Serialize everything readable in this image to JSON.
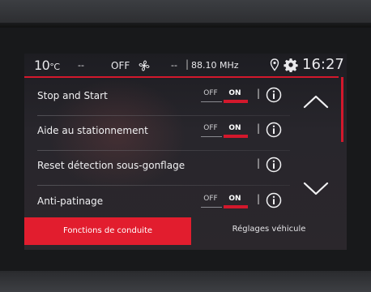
{
  "status_bar": {
    "temperature": "10",
    "temperature_unit": "°C",
    "left_placeholder": "--",
    "climate_state": "OFF",
    "fan_icon": "fan-icon",
    "right_placeholder": "--",
    "separator": "|",
    "radio_frequency": "88.10 MHz",
    "location_icon": "location-pin-icon",
    "settings_icon": "gear-icon",
    "clock": "16:27"
  },
  "settings": [
    {
      "label": "Stop and Start",
      "has_toggle": true,
      "off_label": "OFF",
      "on_label": "ON",
      "state": "on",
      "info_icon": "info-icon"
    },
    {
      "label": "Aide au stationnement",
      "has_toggle": true,
      "off_label": "OFF",
      "on_label": "ON",
      "state": "on",
      "info_icon": "info-icon"
    },
    {
      "label": "Reset détection sous-gonflage",
      "has_toggle": false,
      "info_icon": "info-icon"
    },
    {
      "label": "Anti-patinage",
      "has_toggle": true,
      "off_label": "OFF",
      "on_label": "ON",
      "state": "on",
      "info_icon": "info-icon"
    }
  ],
  "row_separator": "|",
  "scroll": {
    "up_icon": "chevron-up-icon",
    "down_icon": "chevron-down-icon"
  },
  "tabs": [
    {
      "label": "Fonctions de conduite",
      "active": true
    },
    {
      "label": "Réglages véhicule",
      "active": false
    }
  ],
  "colors": {
    "accent": "#e21d2e",
    "background": "#262429",
    "text": "#f1f1f3"
  }
}
